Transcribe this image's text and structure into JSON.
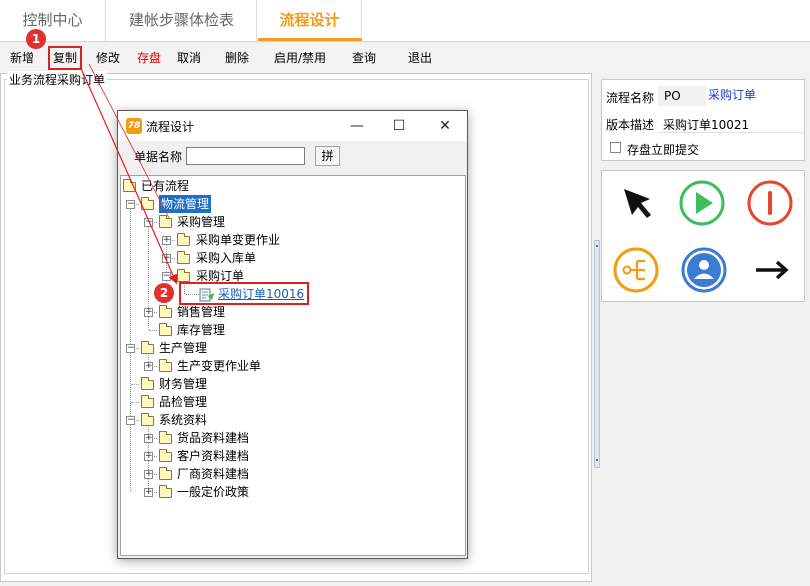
{
  "tabs": [
    {
      "label": "控制中心"
    },
    {
      "label": "建帐步骤体检表"
    },
    {
      "label": "流程设计"
    }
  ],
  "toolbar": {
    "new": "新增",
    "copy": "复制",
    "modify": "修改",
    "save": "存盘",
    "cancel": "取消",
    "delete": "删除",
    "enable": "启用/禁用",
    "query": "查询",
    "exit": "退出"
  },
  "left_panel": {
    "title": "业务流程采购订单"
  },
  "props": {
    "name_label": "流程名称",
    "name_value": "PO",
    "name_link": "采购订单",
    "desc_label": "版本描述",
    "desc_value": "采购订单10021",
    "save_submit_label": "存盘立即提交"
  },
  "palette": {
    "icons": [
      "pointer-arrow-icon",
      "play-icon",
      "stop-icon",
      "branch-icon",
      "user-icon",
      "connector-arrow-icon"
    ],
    "colors": {
      "play": "#3dbd5c",
      "stop": "#e8452f",
      "branch": "#f39c12",
      "user": "#3a7bd5"
    }
  },
  "dialog": {
    "title": "流程设计",
    "logo_text": "78",
    "docname_label": "单据名称",
    "docname_value": "",
    "pin_button": "拼",
    "controls": {
      "minimize": "—",
      "maximize": "☐",
      "close": "✕"
    }
  },
  "tree": {
    "root": "已有流程",
    "logistics": "物流管理",
    "purchase": "采购管理",
    "po_change": "采购单变更作业",
    "po_inbound": "采购入库单",
    "po_order": "采购订单",
    "po_doc": "采购订单10016",
    "sales": "销售管理",
    "inventory": "库存管理",
    "production": "生产管理",
    "prod_change": "生产变更作业单",
    "finance": "财务管理",
    "qc": "品检管理",
    "system": "系统资料",
    "goods": "货品资料建档",
    "customer": "客户资料建档",
    "vendor": "厂商资料建档",
    "pricing": "一般定价政策"
  },
  "badges": {
    "step1": "1",
    "step2": "2"
  },
  "accent_color": "#f29a1f",
  "highlight_color": "#e02020"
}
